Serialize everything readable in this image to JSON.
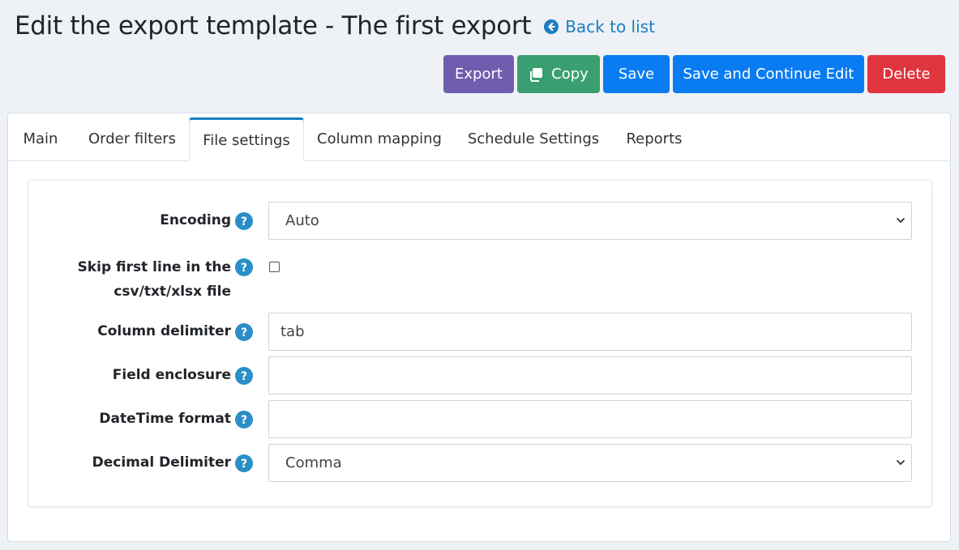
{
  "header": {
    "title": "Edit the export template - The first export",
    "back_link": "Back to list"
  },
  "toolbar": {
    "export_label": "Export",
    "copy_label": "Copy",
    "save_label": "Save",
    "save_continue_label": "Save and Continue Edit",
    "delete_label": "Delete"
  },
  "tabs": [
    {
      "label": "Main",
      "active": false
    },
    {
      "label": "Order filters",
      "active": false
    },
    {
      "label": "File settings",
      "active": true
    },
    {
      "label": "Column mapping",
      "active": false
    },
    {
      "label": "Schedule Settings",
      "active": false
    },
    {
      "label": "Reports",
      "active": false
    }
  ],
  "form": {
    "encoding": {
      "label": "Encoding",
      "value": "Auto"
    },
    "skip_first_line": {
      "label_line1": "Skip first line in the",
      "label_line2": "csv/txt/xlsx file",
      "checked": false
    },
    "column_delimiter": {
      "label": "Column delimiter",
      "value": "tab"
    },
    "field_enclosure": {
      "label": "Field enclosure",
      "value": ""
    },
    "datetime_format": {
      "label": "DateTime format",
      "value": ""
    },
    "decimal_delimiter": {
      "label": "Decimal Delimiter",
      "value": "Comma"
    }
  },
  "colors": {
    "accent": "#1a7ec2",
    "export": "#6f5db0",
    "copy": "#3a9f70",
    "save": "#0a7cf2",
    "delete": "#e0343f",
    "help": "#2a8fc7"
  },
  "icons": {
    "back": "arrow-circle-left-icon",
    "copy": "copy-icon",
    "help": "question-circle-icon",
    "dropdown": "chevron-down-icon"
  }
}
